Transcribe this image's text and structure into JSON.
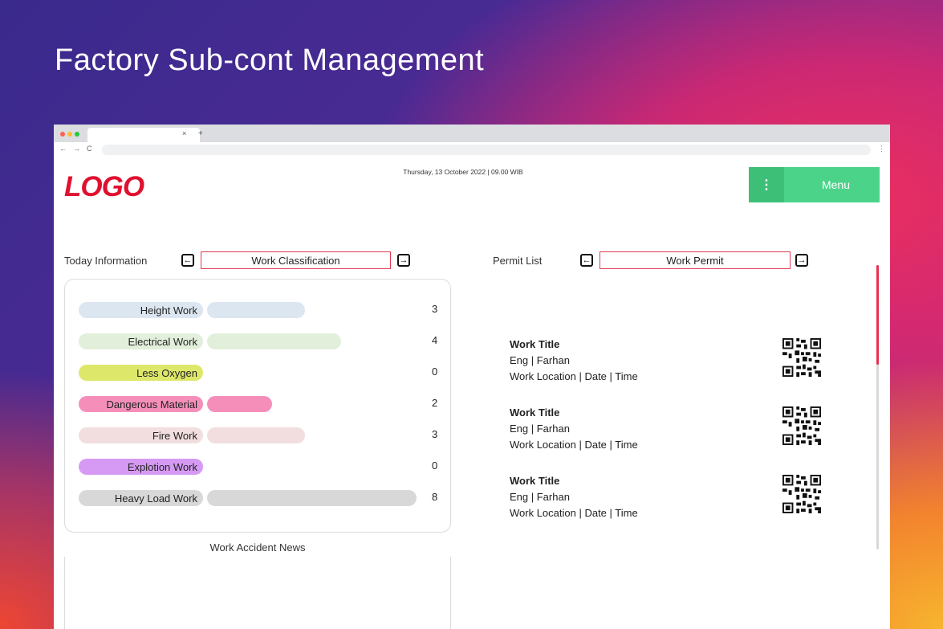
{
  "headline": "Factory Sub-cont Management",
  "browser": {
    "tab_close": "×",
    "tab_new": "+",
    "nav": {
      "back": "←",
      "forward": "→",
      "reload": "C"
    },
    "more": "⋮"
  },
  "header": {
    "logo": "LOGO",
    "datetime": "Thursday, 13 October 2022 | 09.00 WIB",
    "menu_icon": "⋮",
    "menu_label": "Menu"
  },
  "today": {
    "label": "Today Information",
    "selector": "Work Classification",
    "prev_icon": "arrow-left-icon",
    "next_icon": "arrow-right-icon",
    "rows": [
      {
        "label": "Height Work",
        "count": "3",
        "color": "#dce6f1"
      },
      {
        "label": "Electrical Work",
        "count": "4",
        "color": "#e2efdb"
      },
      {
        "label": "Less Oxygen",
        "count": "0",
        "color": "#dde86a"
      },
      {
        "label": "Dangerous Material",
        "count": "2",
        "color": "#f58fba"
      },
      {
        "label": "Fire Work",
        "count": "3",
        "color": "#f2dede"
      },
      {
        "label": "Explotion Work",
        "count": "0",
        "color": "#d69af4"
      },
      {
        "label": "Heavy Load Work",
        "count": "8",
        "color": "#d8d8d8"
      }
    ],
    "news_label": "Work Accident News"
  },
  "permits": {
    "label": "Permit List",
    "selector": "Work Permit",
    "items": [
      {
        "title": "Work Title",
        "engineer": "Eng | Farhan",
        "meta": "Work Location | Date | Time",
        "qr_icon": "qr-code-icon"
      },
      {
        "title": "Work Title",
        "engineer": "Eng | Farhan",
        "meta": "Work Location | Date | Time",
        "qr_icon": "qr-code-icon"
      },
      {
        "title": "Work Title",
        "engineer": "Eng | Farhan",
        "meta": "Work Location | Date | Time",
        "qr_icon": "qr-code-icon"
      }
    ]
  },
  "colors": {
    "accent_green": "#4cd38a",
    "accent_red": "#e0102f",
    "selector_border": "#e03a55"
  }
}
